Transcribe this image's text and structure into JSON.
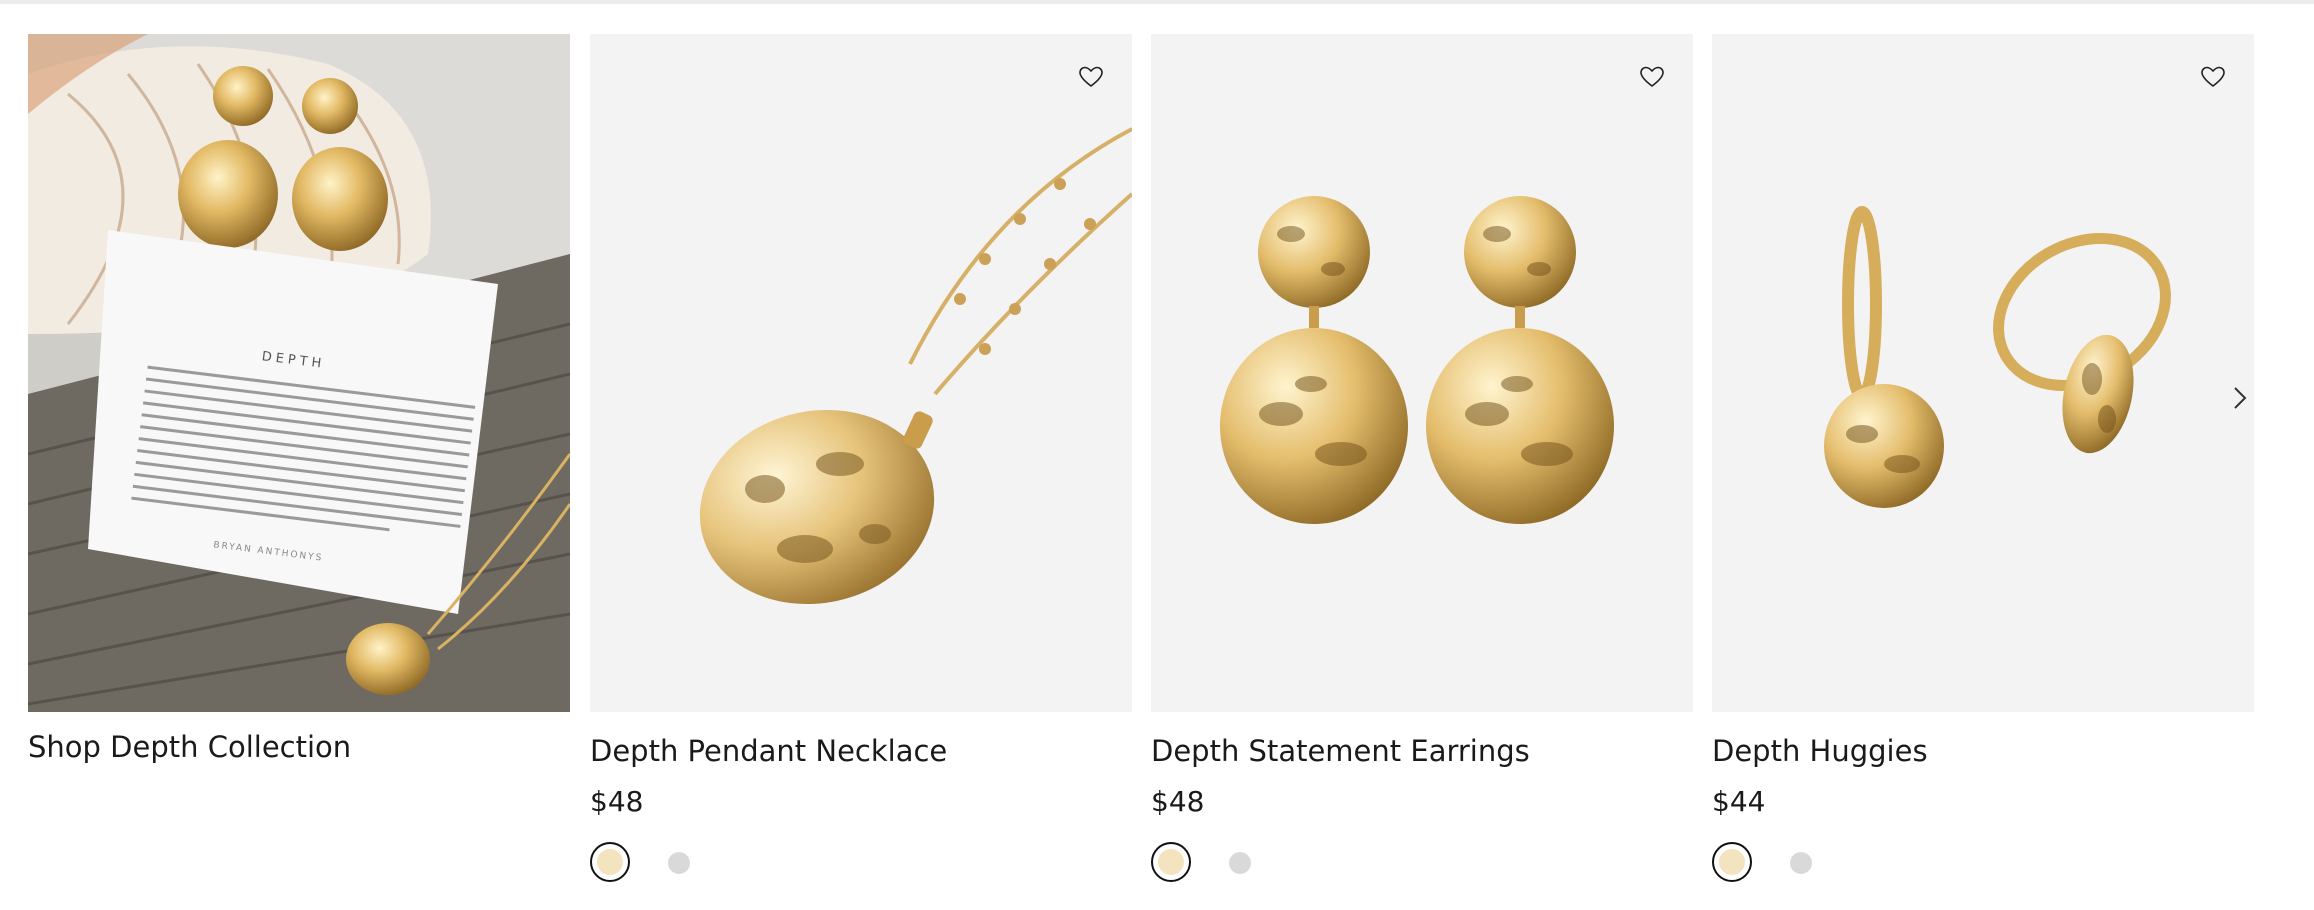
{
  "promo": {
    "title": "Shop Depth Collection",
    "card_heading": "DEPTH",
    "card_text": "She is beautiful beyond the surface, made of infinite depths and endless facets. Humble yet powerful, she is strong in the softest of ways — moving and stretching beyond what is known, continuously transforming and growing through the unfamiliar. Fierce yet calm, she dances amongst the tides, allowing herself to breathe and rest even in moments of change. Mysterious yet unmistakable, her story is always unfolding but her heart is always unwavering — open and full like the sea itself.",
    "card_brand": "BRYAN ANTHONYS"
  },
  "products": [
    {
      "name": "Depth Pendant Necklace",
      "price": "$48",
      "image_icon": "pendant-necklace-image"
    },
    {
      "name": "Depth Statement Earrings",
      "price": "$48",
      "image_icon": "statement-earrings-image"
    },
    {
      "name": "Depth Huggies",
      "price": "$44",
      "image_icon": "huggie-earrings-image"
    }
  ],
  "swatch_colors": {
    "gold": "#f3e3bf",
    "silver": "#d9d9d9"
  },
  "favorite_icon": "heart-outline-icon",
  "next_icon": "chevron-right-icon",
  "colors": {
    "background": "#ffffff",
    "image_bg": "#f3f3f3",
    "text": "#1a1a1a",
    "gold": "#d9b262"
  }
}
